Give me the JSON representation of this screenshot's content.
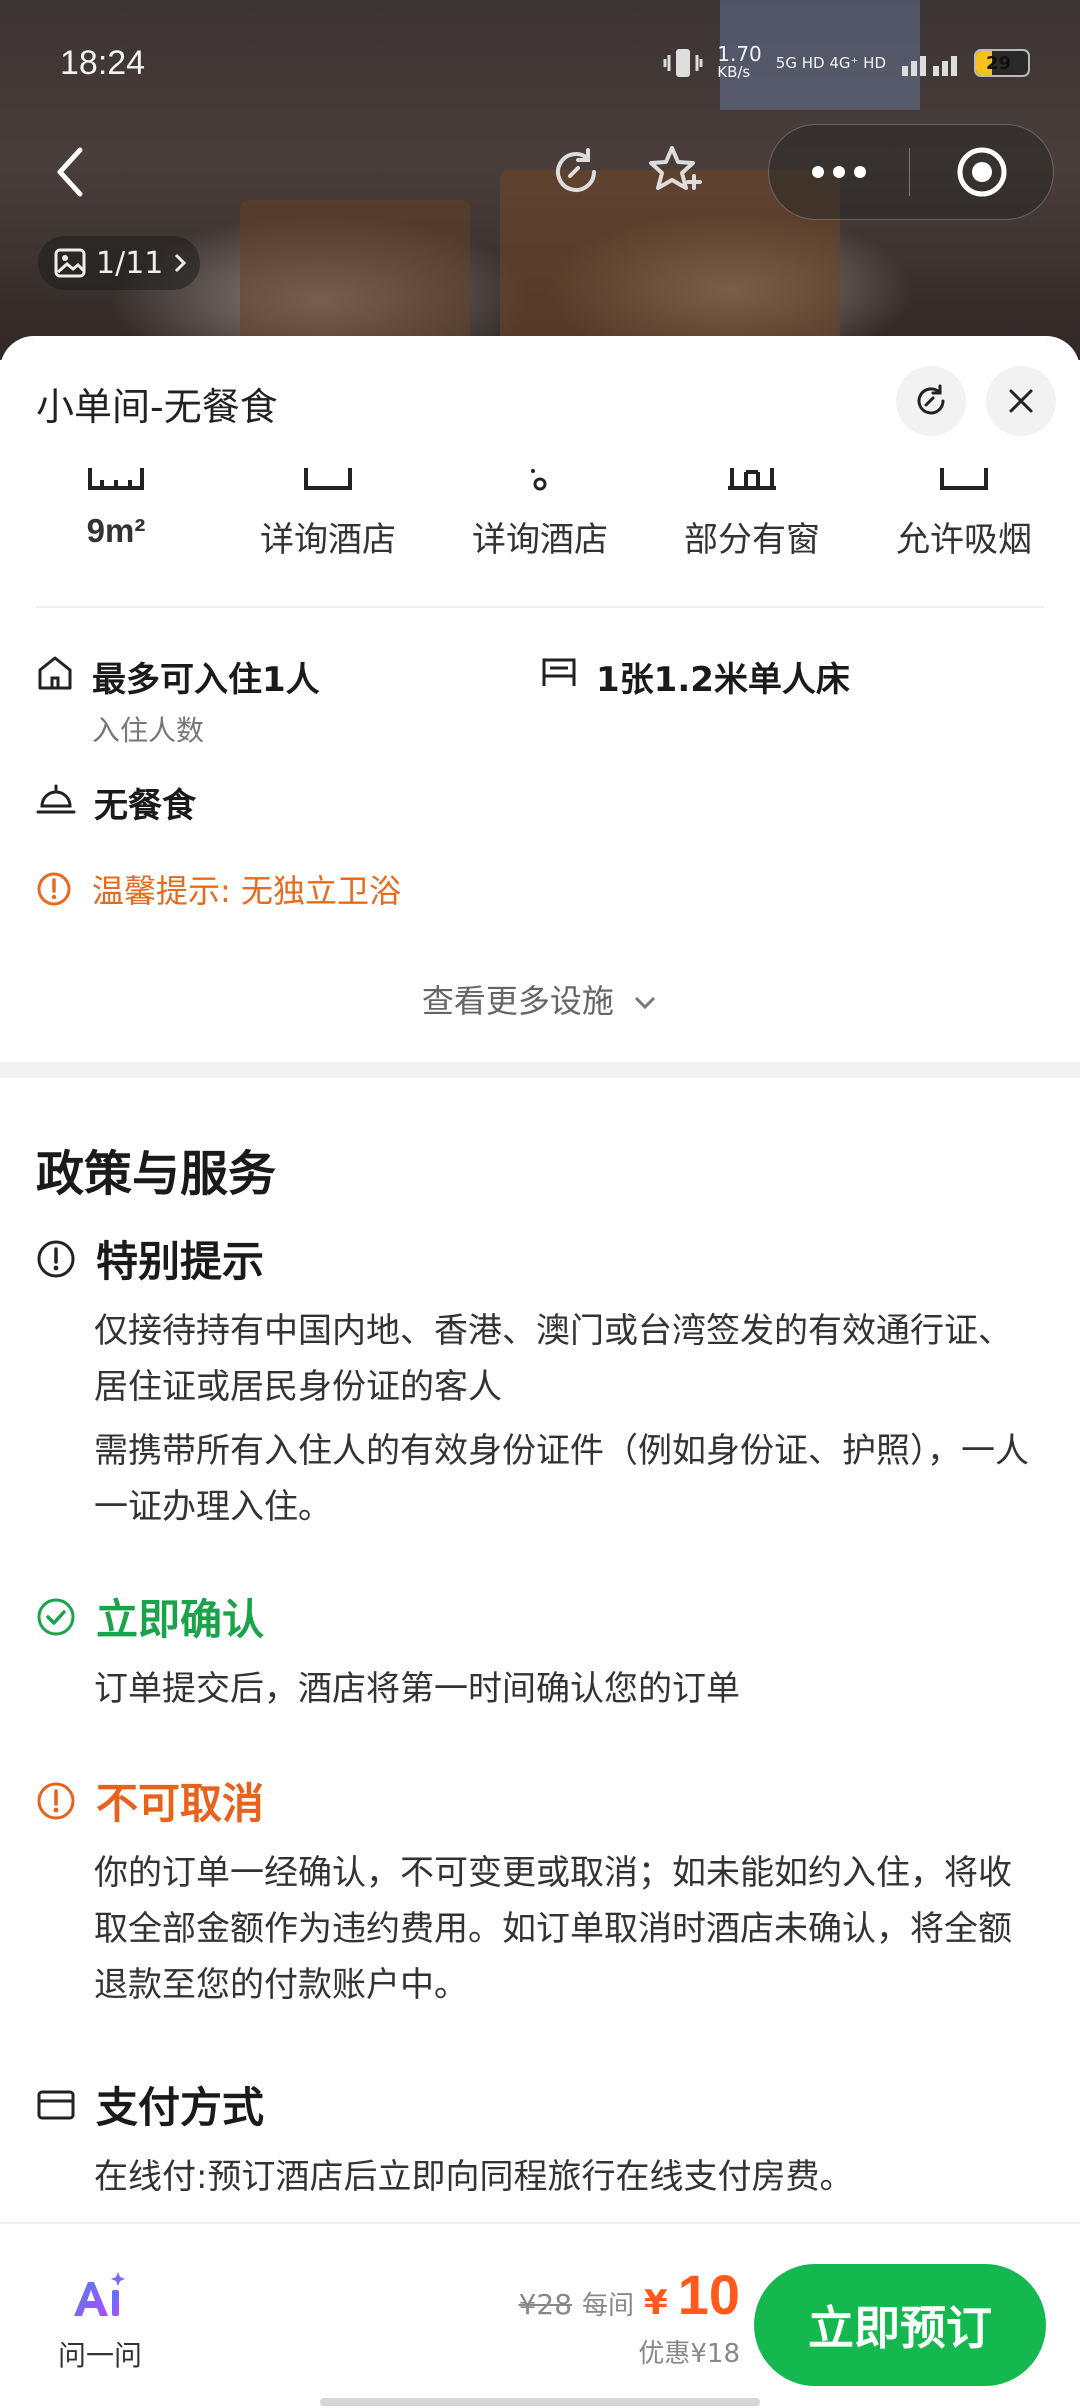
{
  "status_bar": {
    "time": "18:24",
    "speed": "1.70",
    "speed_unit": "KB/s",
    "network": "5G HD 4G⁺ HD",
    "battery": "29"
  },
  "gallery": {
    "counter": "1/11"
  },
  "room": {
    "title": "小单间-无餐食"
  },
  "facilities": [
    {
      "label": "9m²",
      "icon": "area-icon"
    },
    {
      "label": "详询酒店",
      "icon": "floor-icon"
    },
    {
      "label": "详询酒店",
      "icon": "wifi-icon"
    },
    {
      "label": "部分有窗",
      "icon": "window-icon"
    },
    {
      "label": "允许吸烟",
      "icon": "smoking-icon"
    }
  ],
  "occupancy": {
    "title": "最多可入住1人",
    "sub": "入住人数"
  },
  "bed": {
    "title": "1张1.2米单人床"
  },
  "meal": {
    "title": "无餐食"
  },
  "warning": "温馨提示: 无独立卫浴",
  "more_facilities": "查看更多设施",
  "policy_section": {
    "title": "政策与服务",
    "special": {
      "title": "特别提示",
      "lines": [
        "仅接待持有中国内地、香港、澳门或台湾签发的有效通行证、居住证或居民身份证的客人",
        "需携带所有入住人的有效身份证件（例如身份证、护照），一人一证办理入住。"
      ]
    },
    "confirm": {
      "title": "立即确认",
      "text": "订单提交后，酒店将第一时间确认您的订单",
      "color": "#1aa34a"
    },
    "cancel": {
      "title": "不可取消",
      "text": "你的订单一经确认，不可变更或取消；如未能如约入住，将收取全部金额作为违约费用。如订单取消时酒店未确认，将全额退款至您的付款账户中。",
      "color": "#e8621c"
    },
    "payment": {
      "title": "支付方式",
      "text": "在线付:预订酒店后立即向同程旅行在线支付房费。"
    }
  },
  "bottom_bar": {
    "ask_label": "问一问",
    "original_price": "¥28",
    "per_room": "每间",
    "currency": "¥",
    "price": "10",
    "discount": "优惠¥18",
    "book_label": "立即预订",
    "accent": "#15b84f",
    "price_color": "#ff5a1c"
  }
}
